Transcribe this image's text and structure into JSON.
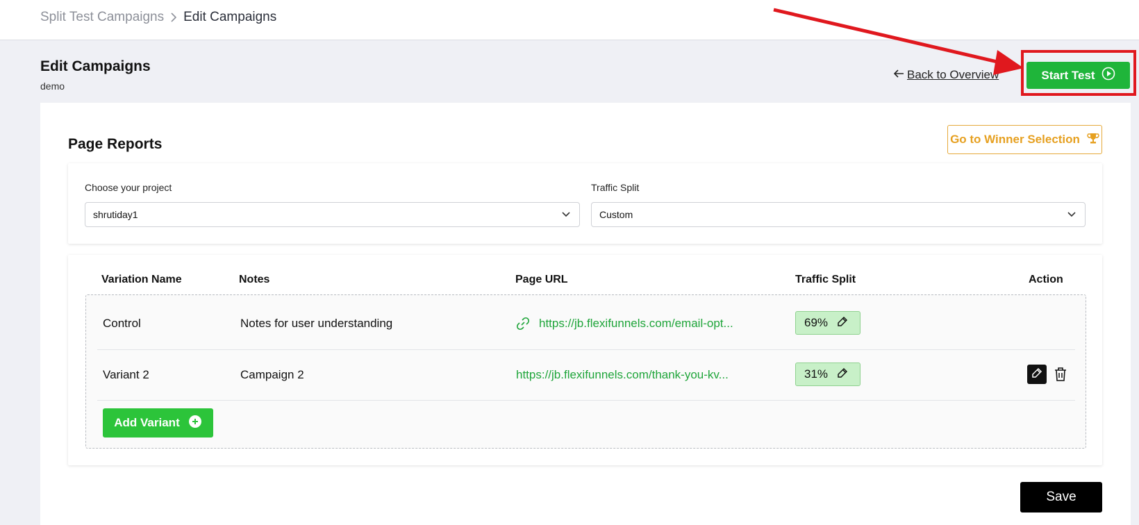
{
  "breadcrumb": {
    "parent": "Split Test Campaigns",
    "current": "Edit Campaigns"
  },
  "header": {
    "title": "Edit Campaigns",
    "subtitle": "demo",
    "back_label": "Back to Overview",
    "start_label": "Start Test"
  },
  "reports": {
    "title": "Page Reports",
    "winner_label": "Go to Winner Selection",
    "project_label": "Choose your project",
    "project_value": "shrutiday1",
    "split_label": "Traffic Split",
    "split_value": "Custom"
  },
  "table": {
    "headers": [
      "Variation Name",
      "Notes",
      "Page URL",
      "Traffic Split",
      "Action"
    ],
    "rows": [
      {
        "name": "Control",
        "notes": "Notes for user understanding",
        "url": "https://jb.flexifunnels.com/email-opt...",
        "split": "69%"
      },
      {
        "name": "Variant 2",
        "notes": "Campaign 2",
        "url": "https://jb.flexifunnels.com/thank-you-kv...",
        "split": "31%"
      }
    ]
  },
  "add_variant_label": "Add Variant",
  "save_label": "Save",
  "colors": {
    "primary_green": "#1fb53a",
    "accent_orange": "#e6a020",
    "highlight_red": "#e0181e"
  },
  "icons": [
    "chevron-right-icon",
    "arrow-left-icon",
    "play-circle-icon",
    "trophy-icon",
    "chevron-down-icon",
    "link-icon",
    "edit-icon",
    "trash-icon",
    "plus-circle-icon"
  ]
}
